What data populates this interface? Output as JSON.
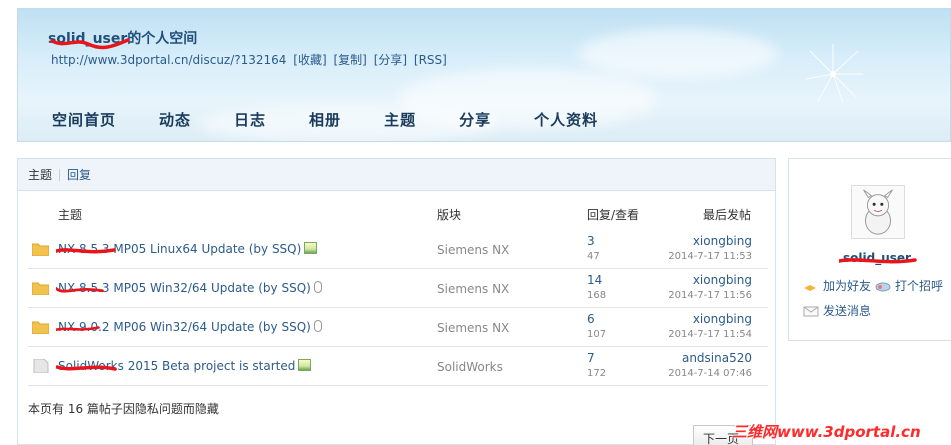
{
  "header": {
    "space_title": "solid_user的个人空间",
    "space_url": "http://www.3dportal.cn/discuz/?132164",
    "url_actions": [
      "[收藏]",
      "[复制]",
      "[分享]",
      "[RSS]"
    ],
    "nav": [
      "空间首页",
      "动态",
      "日志",
      "相册",
      "主题",
      "分享",
      "个人资料"
    ]
  },
  "tabs": {
    "topics": "主题",
    "replies": "回复"
  },
  "table": {
    "headers": {
      "subject": "主题",
      "forum": "版块",
      "replies_views": "回复/查看",
      "last_post": "最后发帖"
    },
    "rows": [
      {
        "subject": "NX 8.5.3 MP05 Linux64 Update (by SSQ)",
        "forum": "Siemens NX",
        "replies": "3",
        "views": "47",
        "poster": "xiongbing",
        "date": "2014-7-17 11:53",
        "attachment": "image",
        "folder": "hot"
      },
      {
        "subject": "NX 8.5.3 MP05 Win32/64 Update (by SSQ)",
        "forum": "Siemens NX",
        "replies": "14",
        "views": "168",
        "poster": "xiongbing",
        "date": "2014-7-17 11:56",
        "attachment": "clip",
        "folder": "hot"
      },
      {
        "subject": "NX 9.0.2 MP06 Win32/64 Update (by SSQ)",
        "forum": "Siemens NX",
        "replies": "6",
        "views": "107",
        "poster": "xiongbing",
        "date": "2014-7-17 11:54",
        "attachment": "clip",
        "folder": "hot"
      },
      {
        "subject": "SolidWorks 2015 Beta project is started",
        "forum": "SolidWorks",
        "replies": "7",
        "views": "172",
        "poster": "andsina520",
        "date": "2014-7-14 07:46",
        "attachment": "image",
        "folder": "normal"
      }
    ]
  },
  "hidden_note": "本页有 16 篇帖子因隐私问题而隐藏",
  "profile": {
    "username": "solid_user",
    "actions": [
      "加为好友",
      "打个招呼",
      "发送消息"
    ]
  },
  "pager": {
    "next": "下一页"
  },
  "watermark": "三维网www.3dportal.cn",
  "colors": {
    "link": "#2b5b8c",
    "folder_hot": "#f2c24e",
    "folder_normal": "#e6e6e6",
    "redaction": "#e8161c",
    "watermark": "#ff2a2a"
  }
}
